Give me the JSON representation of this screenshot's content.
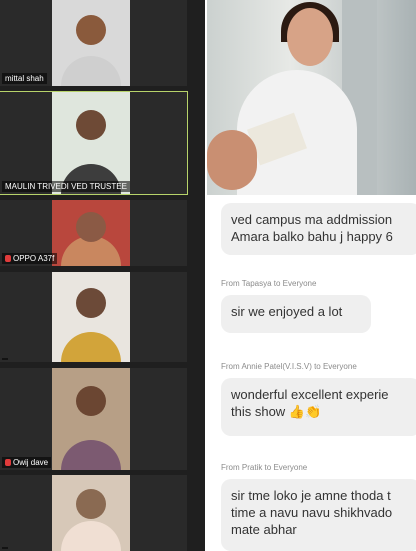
{
  "participants": [
    {
      "name": "mittal shah"
    },
    {
      "name": "MAULIN TRIVEDI VED TRUSTEE"
    },
    {
      "name": "OPPO A37f"
    },
    {
      "name": ""
    },
    {
      "name": "Owij dave"
    },
    {
      "name": ""
    }
  ],
  "chat": {
    "messages": [
      {
        "from": "",
        "text": "ved campus ma addmission\nAmara balko bahu j happy 6"
      },
      {
        "from": "From Tapasya to Everyone",
        "text": "sir we enjoyed a lot"
      },
      {
        "from": "From Annie Patel(V.I.S.V) to Everyone",
        "text": "wonderful excellent experie\nthis show 👍👏"
      },
      {
        "from": "From Pratik to Everyone",
        "text": "sir tme loko je amne thoda t\ntime a navu navu shikhvado\nmate abhar"
      }
    ]
  },
  "colors": {
    "active_speaker": "#b7d36a",
    "chat_bubble": "#efefef",
    "grid_bg": "#1f1f1f"
  }
}
